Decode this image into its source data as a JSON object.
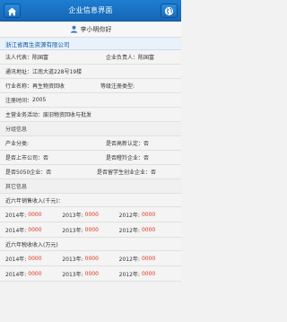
{
  "header": {
    "title": "企业信息界面",
    "back_icon": "home-icon",
    "action_icon": "globe-icon"
  },
  "user": {
    "name": "李小明你好",
    "icon": "user-icon"
  },
  "company": {
    "name": "浙江省再生资源有限公司"
  },
  "info": {
    "legal_rep_label": "法人代表：",
    "legal_rep_value": "陈国富",
    "principal_label": "企业负责人：",
    "principal_value": "陈国富",
    "address_label": "通讯地址：",
    "address_value": "江南大道228号19楼",
    "industry_label": "行业名称：",
    "industry_value": "再生物资回收",
    "reg_type_label": "等级注册类型:",
    "reg_type_value": "",
    "reg_time_label": "注册时间：",
    "reg_time_value": "2005",
    "business_label": "主营业务活动：",
    "business_value": "废旧物资回收与批发"
  },
  "sections": {
    "group_info": "分组信息",
    "other_info": "其它信息"
  },
  "group": {
    "industry_cat_label": "产业分类:",
    "industry_cat_value": "",
    "hightech_label": "是否高新认定：",
    "hightech_value": "否",
    "listed_label": "是否上市公司：",
    "listed_value": "否",
    "research_label": "是否瞪羚企业：",
    "research_value": "否",
    "top5050_label": "是否5050企业：",
    "top5050_value": "否",
    "overseas_label": "是否留学生创业企业：",
    "overseas_value": "否"
  },
  "sales": {
    "title": "近六年销售收入(千元)：",
    "rows": [
      [
        {
          "year": "2014年:",
          "value": "0000"
        },
        {
          "year": "2013年:",
          "value": "0000"
        },
        {
          "year": "2012年:",
          "value": "0000"
        }
      ],
      [
        {
          "year": "2014年:",
          "value": "0000"
        },
        {
          "year": "2013年:",
          "value": "0000"
        },
        {
          "year": "2012年:",
          "value": "0000"
        }
      ]
    ]
  },
  "tax": {
    "title": "近六年税收收入(万元)",
    "rows": [
      [
        {
          "year": "2014年:",
          "value": "0000"
        },
        {
          "year": "2013年:",
          "value": "0000"
        },
        {
          "year": "2012年:",
          "value": "0000"
        }
      ],
      [
        {
          "year": "2014年:",
          "value": "0000"
        },
        {
          "year": "2013年:",
          "value": "0000"
        },
        {
          "year": "2012年:",
          "value": "0000"
        }
      ]
    ]
  },
  "colors": {
    "header_blue": "#1567b5",
    "company_text": "#0c58a6",
    "value_red": "#e0331a"
  }
}
